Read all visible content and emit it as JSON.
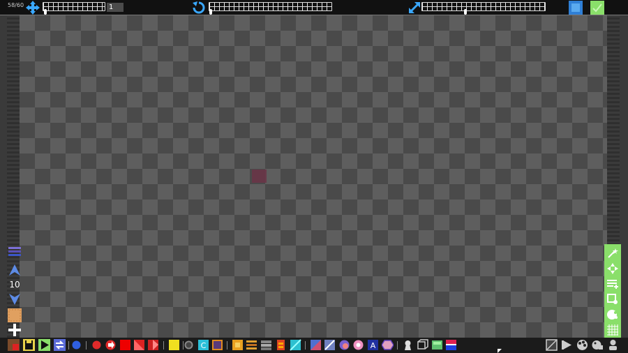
{
  "fps": "58/60",
  "move_value": "1",
  "layer_number": "10"
}
